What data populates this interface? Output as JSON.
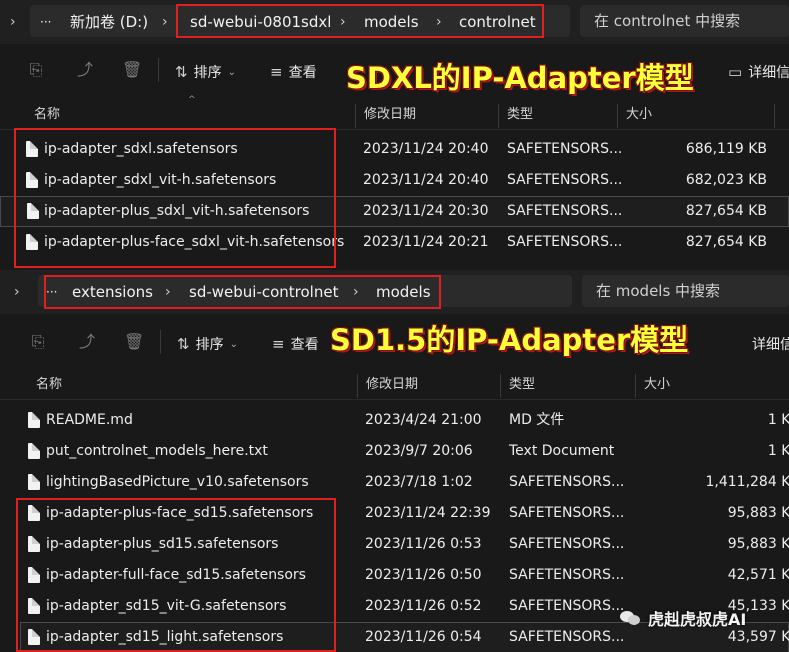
{
  "panel1": {
    "address": {
      "ellipsis": "···",
      "crumbs": [
        "新加卷 (D:)",
        "sd-webui-0801sdxl",
        "models",
        "controlnet"
      ]
    },
    "search_placeholder": "在 controlnet 中搜索",
    "toolbar": {
      "sort_label": "排序",
      "view_label": "查看",
      "details_label": "详细信"
    },
    "overlay_title": "SDXL的IP-Adapter模型",
    "columns": {
      "name": "名称",
      "date": "修改日期",
      "type": "类型",
      "size": "大小"
    },
    "files": [
      {
        "name": "ip-adapter_sdxl.safetensors",
        "date": "2023/11/24 20:40",
        "type": "SAFETENSORS...",
        "size": "686,119 KB"
      },
      {
        "name": "ip-adapter_sdxl_vit-h.safetensors",
        "date": "2023/11/24 20:40",
        "type": "SAFETENSORS...",
        "size": "682,023 KB"
      },
      {
        "name": "ip-adapter-plus_sdxl_vit-h.safetensors",
        "date": "2023/11/24 20:30",
        "type": "SAFETENSORS...",
        "size": "827,654 KB"
      },
      {
        "name": "ip-adapter-plus-face_sdxl_vit-h.safetensors",
        "date": "2023/11/24 20:21",
        "type": "SAFETENSORS...",
        "size": "827,654 KB"
      }
    ]
  },
  "panel2": {
    "address": {
      "ellipsis": "···",
      "crumbs": [
        "extensions",
        "sd-webui-controlnet",
        "models"
      ]
    },
    "search_placeholder": "在 models 中搜索",
    "toolbar": {
      "sort_label": "排序",
      "view_label": "查看",
      "details_label": "详细信"
    },
    "overlay_title": "SD1.5的IP-Adapter模型",
    "columns": {
      "name": "名称",
      "date": "修改日期",
      "type": "类型",
      "size": "大小"
    },
    "files": [
      {
        "name": "README.md",
        "date": "2023/4/24 21:00",
        "type": "MD 文件",
        "size": "1 KB"
      },
      {
        "name": "put_controlnet_models_here.txt",
        "date": "2023/9/7 20:06",
        "type": "Text Document",
        "size": "1 KB"
      },
      {
        "name": "lightingBasedPicture_v10.safetensors",
        "date": "2023/7/18 1:02",
        "type": "SAFETENSORS...",
        "size": "1,411,284 KB"
      },
      {
        "name": "ip-adapter-plus-face_sd15.safetensors",
        "date": "2023/11/24 22:39",
        "type": "SAFETENSORS...",
        "size": "95,883 KB"
      },
      {
        "name": "ip-adapter-plus_sd15.safetensors",
        "date": "2023/11/26 0:53",
        "type": "SAFETENSORS...",
        "size": "95,883 KB"
      },
      {
        "name": "ip-adapter-full-face_sd15.safetensors",
        "date": "2023/11/26 0:50",
        "type": "SAFETENSORS...",
        "size": "42,571 KB"
      },
      {
        "name": "ip-adapter_sd15_vit-G.safetensors",
        "date": "2023/11/26 0:52",
        "type": "SAFETENSORS...",
        "size": "45,133 KB"
      },
      {
        "name": "ip-adapter_sd15_light.safetensors",
        "date": "2023/11/26 0:54",
        "type": "SAFETENSORS...",
        "size": "43,597 KB"
      }
    ]
  },
  "watermark": "虎赳虎叔虎AI",
  "colors": {
    "highlight_box": "#e02020",
    "overlay_text": "#ffff3a",
    "background": "#191919"
  }
}
